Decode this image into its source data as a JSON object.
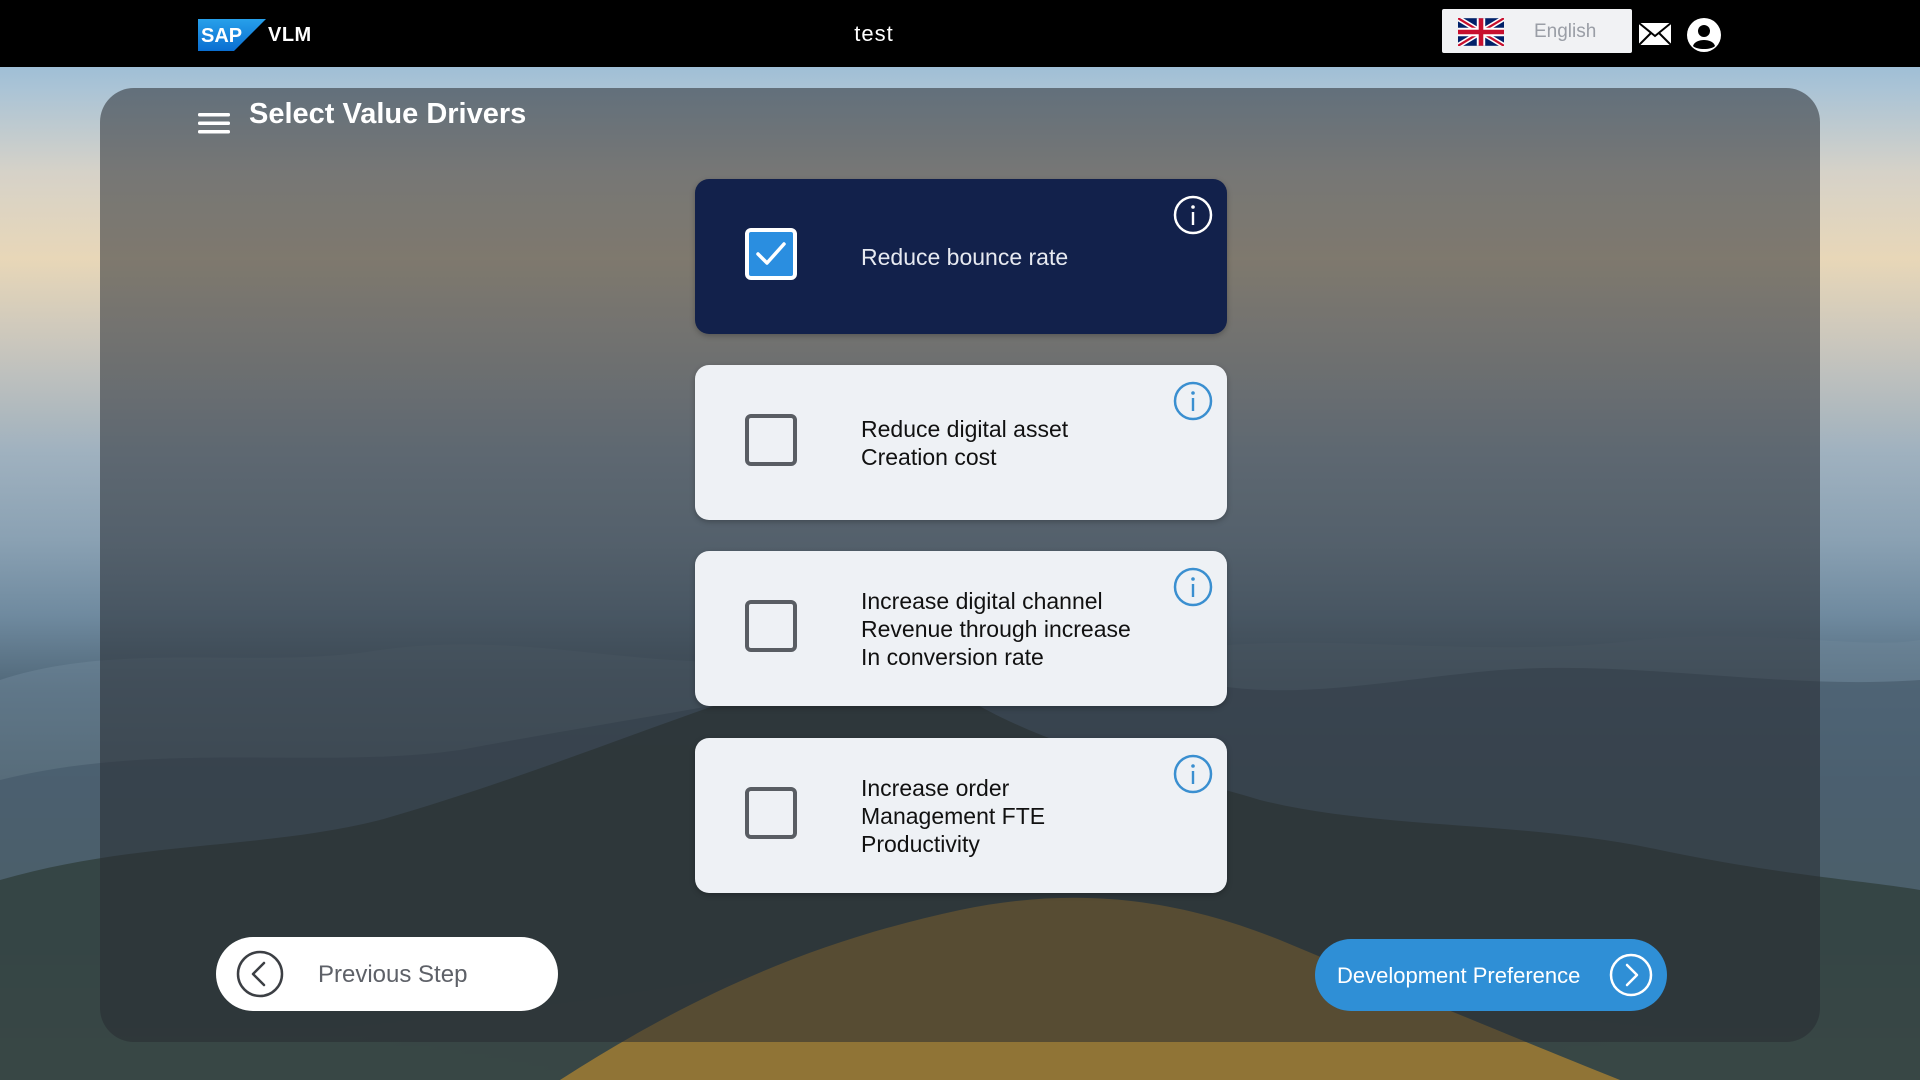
{
  "topbar": {
    "logo_text": "SAP",
    "product": "VLM",
    "title": "test",
    "language": {
      "flag": "uk-flag-icon",
      "label": "English"
    },
    "icons": [
      "mail-icon",
      "user-icon"
    ]
  },
  "page": {
    "title": "Select Value Drivers",
    "menu_icon": "hamburger-menu-icon"
  },
  "value_drivers": [
    {
      "lines": [
        "Reduce bounce rate"
      ],
      "checked": true
    },
    {
      "lines": [
        "Reduce digital asset",
        "Creation cost"
      ],
      "checked": false
    },
    {
      "lines": [
        "Increase digital channel",
        "Revenue through increase",
        "In conversion rate"
      ],
      "checked": false
    },
    {
      "lines": [
        "Increase order",
        "Management FTE",
        "Productivity"
      ],
      "checked": false
    }
  ],
  "navigation": {
    "previous_label": "Previous Step",
    "next_label": "Development Preference"
  },
  "colors": {
    "topbar": "#000000",
    "selected_card": "#12214b",
    "card": "#eef1f5",
    "accent_blue": "#2f8fd6",
    "checkbox_checked": "#2a8ee0",
    "info_icon": "#3a8fd0"
  }
}
